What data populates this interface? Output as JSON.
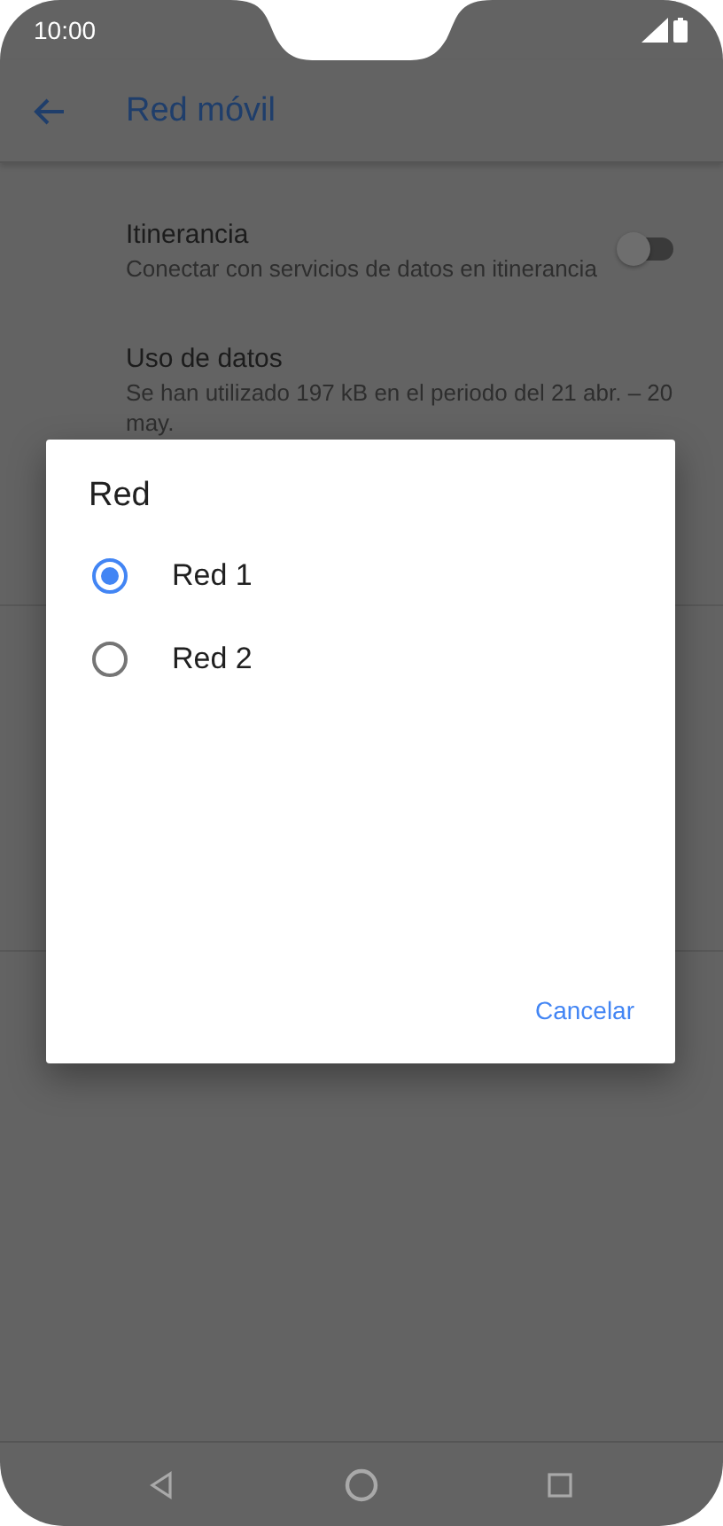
{
  "status_bar": {
    "time": "10:00"
  },
  "app_bar": {
    "title": "Red móvil"
  },
  "settings": [
    {
      "kind": "toggle",
      "title": "Itinerancia",
      "subtitle": "Conectar con servicios de datos en itinerancia",
      "on": false
    },
    {
      "kind": "text",
      "title": "Uso de datos",
      "subtitle": "Se han utilizado 197 kB en el periodo del 21 abr. – 20 may."
    }
  ],
  "dialog": {
    "title": "Red",
    "options": [
      {
        "label": "Red 1",
        "selected": true
      },
      {
        "label": "Red 2",
        "selected": false
      }
    ],
    "buttons": [
      "Cancelar"
    ]
  }
}
